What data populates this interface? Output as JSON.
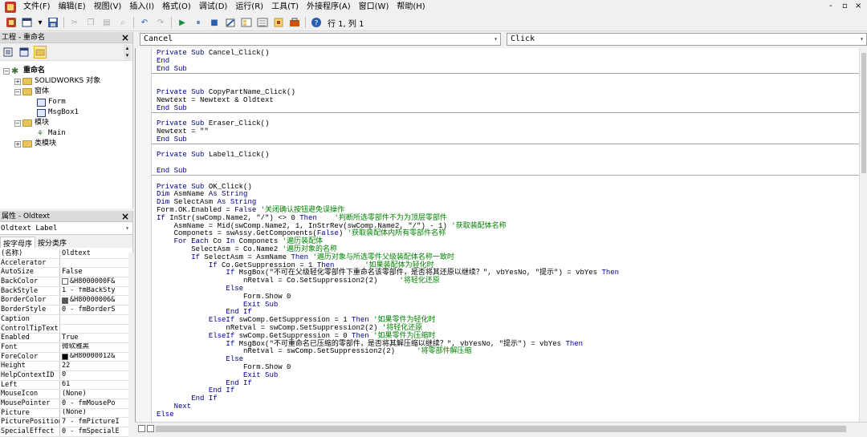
{
  "menu": {
    "items": [
      "文件(F)",
      "编辑(E)",
      "视图(V)",
      "插入(I)",
      "格式(O)",
      "调试(D)",
      "运行(R)",
      "工具(T)",
      "外接程序(A)",
      "窗口(W)",
      "帮助(H)"
    ],
    "window_controls": [
      "-",
      "▫",
      "×"
    ]
  },
  "toolbar": {
    "position_text": "行 1, 列 1"
  },
  "project_pane": {
    "title": "工程 - 重命名",
    "close": "×",
    "tree": {
      "root": "重命名",
      "solidworks": "SOLIDWORKS 对象",
      "forms_folder": "窗体",
      "form": "Form",
      "msgbox": "MsgBox1",
      "modules_folder": "模块",
      "main": "Main",
      "class_folder": "类模块"
    }
  },
  "properties_pane": {
    "title": "属性 - Oldtext",
    "close": "×",
    "object_combo": "Oldtext Label",
    "tabs": [
      "按字母序",
      "按分类序"
    ],
    "rows": [
      {
        "name": "(名称)",
        "value": "Oldtext"
      },
      {
        "name": "Accelerator",
        "value": ""
      },
      {
        "name": "AutoSize",
        "value": "False"
      },
      {
        "name": "BackColor",
        "value": "&H8000000F&",
        "swatch": "#ffffff"
      },
      {
        "name": "BackStyle",
        "value": "1 - fmBackSty"
      },
      {
        "name": "BorderColor",
        "value": "&H80000006&",
        "swatch": "#555555"
      },
      {
        "name": "BorderStyle",
        "value": "0 - fmBorderS"
      },
      {
        "name": "Caption",
        "value": ""
      },
      {
        "name": "ControlTipText",
        "value": ""
      },
      {
        "name": "Enabled",
        "value": "True"
      },
      {
        "name": "Font",
        "value": "微软雅黑"
      },
      {
        "name": "ForeColor",
        "value": "&H80000012&",
        "swatch": "#000000"
      },
      {
        "name": "Height",
        "value": "22"
      },
      {
        "name": "HelpContextID",
        "value": "0"
      },
      {
        "name": "Left",
        "value": "61"
      },
      {
        "name": "MouseIcon",
        "value": "(None)"
      },
      {
        "name": "MousePointer",
        "value": "0 - fmMousePo"
      },
      {
        "name": "Picture",
        "value": "(None)"
      },
      {
        "name": "PicturePosition",
        "value": "7 - fmPictureI"
      },
      {
        "name": "SpecialEffect",
        "value": "0 - fmSpecialE"
      }
    ]
  },
  "code_window": {
    "object_combo": "Cancel",
    "proc_combo": "Click",
    "lines": [
      "Private Sub Cancel_Click()",
      "End",
      "End Sub",
      "",
      "",
      "Private Sub CopyPartName_Click()",
      "Newtext = Newtext & Oldtext",
      "End Sub",
      "",
      "Private Sub Eraser_Click()",
      "Newtext = \"\"",
      "End Sub",
      "",
      "Private Sub Label1_Click()",
      "",
      "End Sub",
      "",
      "Private Sub OK_Click()",
      "Dim AsmName As String",
      "Dim SelectAsm As String",
      "Form.OK.Enabled = False '关闭确认按钮避免误操作",
      "If InStr(swComp.Name2, \"/\") <> 0 Then    '判断所选零部件不为为顶层零部件",
      "    AsmName = Mid(swComp.Name2, 1, InStrRev(swComp.Name2, \"/\") - 1) '获取装配体名称",
      "    Componets = swAssy.GetComponents(False) '获取装配体内所有零部件名称",
      "    For Each Co In Componets '遍历装配体",
      "        SelectAsm = Co.Name2 '遍历对象的名称",
      "        If SelectAsm = AsmName Then '遍历对象与所选零件父级装配体名称一致时",
      "            If Co.GetSuppression = 1 Then       '如果装配体为轻化时",
      "                If MsgBox(\"不可在父级轻化零部件下重命名该零部件，是否将其还原以继续？\", vbYesNo, \"提示\") = vbYes Then",
      "                    nRetval = Co.SetSuppression2(2)     '将轻化还原",
      "                Else",
      "                    Form.Show 0",
      "                    Exit Sub",
      "                End If",
      "            ElseIf swComp.GetSuppression = 1 Then '如果零件为轻化时",
      "                nRetval = swComp.SetSuppression2(2) '将轻化还原",
      "            ElseIf swComp.GetSuppression = 0 Then '如果零件为压缩时",
      "                If MsgBox(\"不可重命名已压缩的零部件，是否将其解压缩以继续？\", vbYesNo, \"提示\") = vbYes Then",
      "                    nRetval = swComp.SetSuppression2(2)     '将零部件解压缩",
      "                Else",
      "                    Form.Show 0",
      "                    Exit Sub",
      "                End If",
      "            End If",
      "        End If",
      "    Next",
      "Else"
    ]
  }
}
